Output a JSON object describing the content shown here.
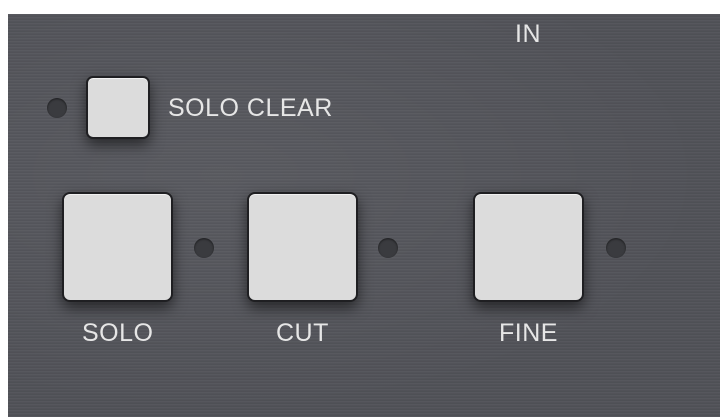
{
  "header": {
    "in_label": "IN"
  },
  "solo_clear": {
    "label": "SOLO CLEAR"
  },
  "buttons": [
    {
      "label": "SOLO"
    },
    {
      "label": "CUT"
    },
    {
      "label": "FINE"
    }
  ]
}
